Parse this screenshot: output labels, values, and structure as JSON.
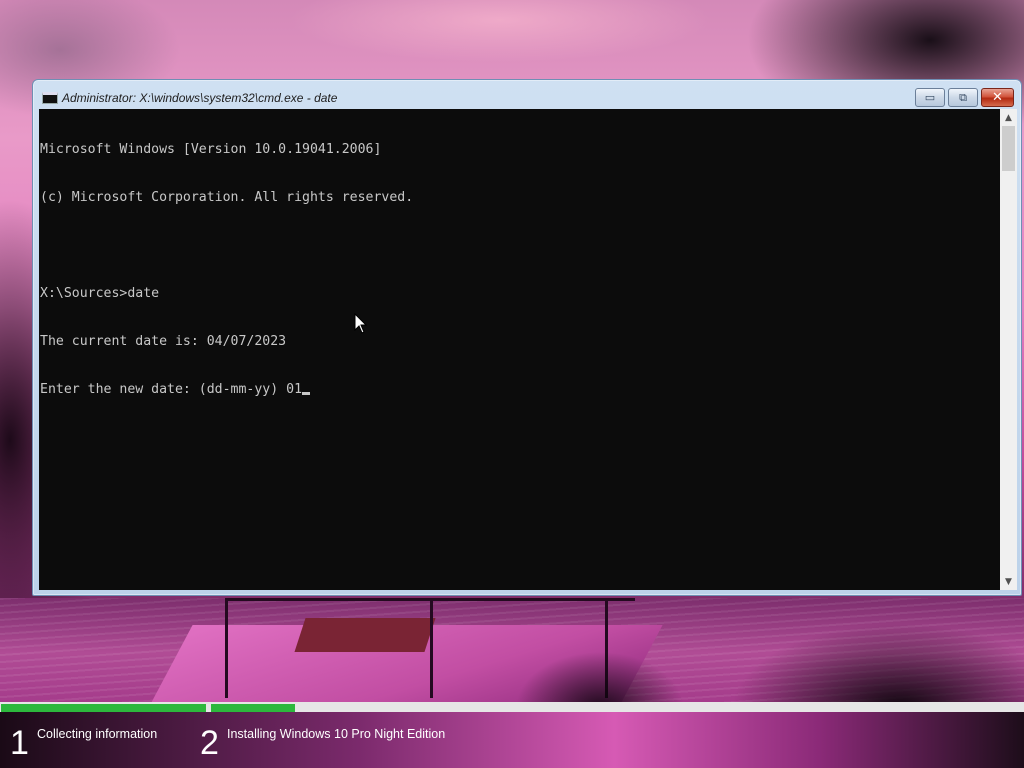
{
  "window": {
    "title": "Administrator: X:\\windows\\system32\\cmd.exe - date",
    "icon": "console-app-icon",
    "controls": {
      "minimize": "▭",
      "maximize": "⧉",
      "close": "✕"
    }
  },
  "console": {
    "lines": [
      "Microsoft Windows [Version 10.0.19041.2006]",
      "(c) Microsoft Corporation. All rights reserved.",
      "",
      "X:\\Sources>date",
      "The current date is: 04/07/2023",
      "Enter the new date: (dd-mm-yy) 01"
    ],
    "text_color": "#c8c8c8",
    "background": "#0c0c0c"
  },
  "scrollbar": {
    "up": "▲",
    "down": "▼"
  },
  "setup": {
    "steps": [
      {
        "number": "1",
        "label": "Collecting information",
        "progress": 1.0
      },
      {
        "number": "2",
        "label": "Installing Windows 10 Pro Night Edition",
        "progress": 0.104
      }
    ],
    "progress_color": "#2db83d"
  }
}
